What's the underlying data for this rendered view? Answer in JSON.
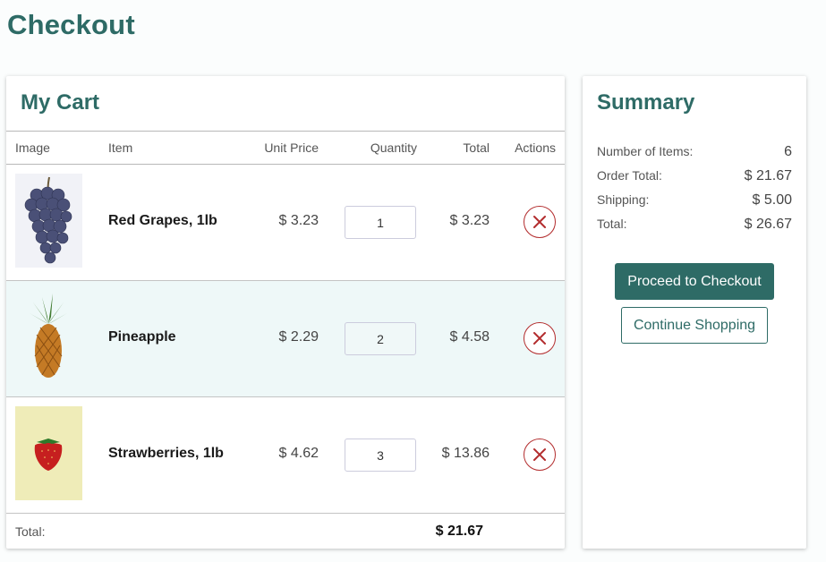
{
  "page": {
    "title": "Checkout"
  },
  "cart": {
    "title": "My Cart",
    "columns": [
      "Image",
      "Item",
      "Unit Price",
      "Quantity",
      "Total",
      "Actions"
    ],
    "items": [
      {
        "name": "Red Grapes, 1lb",
        "unit_price": "$ 3.23",
        "quantity": "1",
        "total": "$ 3.23",
        "image": "grapes-image"
      },
      {
        "name": "Pineapple",
        "unit_price": "$ 2.29",
        "quantity": "2",
        "total": "$ 4.58",
        "image": "pineapple-image"
      },
      {
        "name": "Strawberries, 1lb",
        "unit_price": "$ 4.62",
        "quantity": "3",
        "total": "$ 13.86",
        "image": "strawberry-image"
      }
    ],
    "footer": {
      "label": "Total:",
      "value": "$ 21.67"
    }
  },
  "summary": {
    "title": "Summary",
    "lines": [
      {
        "label": "Number of Items:",
        "value": "6"
      },
      {
        "label": "Order Total:",
        "value": "$ 21.67"
      },
      {
        "label": "Shipping:",
        "value": "$ 5.00"
      },
      {
        "label": "Total:",
        "value": "$ 26.67"
      }
    ],
    "checkout_label": "Proceed to Checkout",
    "continue_label": "Continue Shopping"
  },
  "colors": {
    "accent": "#2e6b66",
    "remove": "#b32d2e",
    "alt_row": "#eef8f8"
  }
}
